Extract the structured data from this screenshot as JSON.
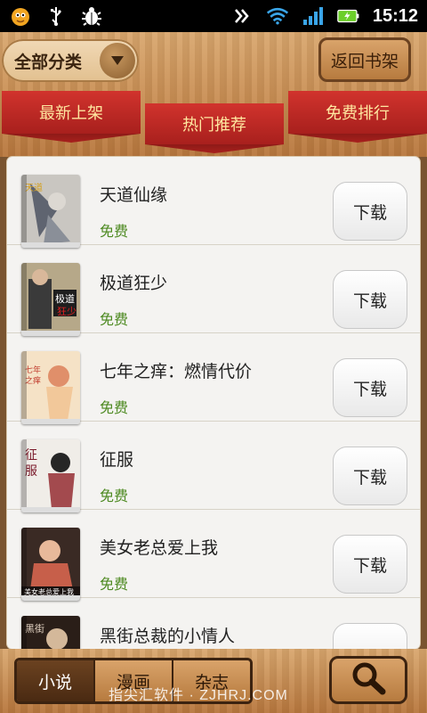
{
  "status_bar": {
    "time": "15:12",
    "icons": [
      "app-icon",
      "usb-icon",
      "bug-icon",
      "sync-icon",
      "wifi-icon",
      "signal-icon",
      "battery-icon"
    ],
    "battery_color": "#6ccf2a"
  },
  "header": {
    "category_label": "全部分类",
    "back_label": "返回书架",
    "tabs": [
      {
        "label": "最新上架",
        "active": false
      },
      {
        "label": "热门推荐",
        "active": true
      },
      {
        "label": "免费排行",
        "active": false
      }
    ]
  },
  "books": [
    {
      "title": "天道仙缘",
      "price": "免费",
      "action": "下载",
      "cover_colors": [
        "#c9c6c1",
        "#5f6470",
        "#dcd8d2"
      ]
    },
    {
      "title": "极道狂少",
      "price": "免费",
      "action": "下载",
      "cover_colors": [
        "#3a3a3a",
        "#b6a889",
        "#1e1e1e"
      ]
    },
    {
      "title": "七年之痒：燃情代价",
      "price": "免费",
      "action": "下载",
      "cover_colors": [
        "#f2c89a",
        "#e08f6a",
        "#f5e2c6"
      ]
    },
    {
      "title": "征服",
      "price": "免费",
      "action": "下载",
      "cover_colors": [
        "#f0ede8",
        "#a34a4e",
        "#262626"
      ]
    },
    {
      "title": "美女老总爱上我",
      "price": "免费",
      "action": "下载",
      "cover_colors": [
        "#3a2a24",
        "#c75f4a",
        "#e8b99a"
      ]
    },
    {
      "title": "黑街总裁的小情人",
      "price": "",
      "action": "",
      "cover_colors": [
        "#2a1e18",
        "#8a5a3a",
        "#d4b89a"
      ]
    }
  ],
  "bottom_tabs": [
    {
      "label": "小说",
      "active": true
    },
    {
      "label": "漫画",
      "active": false
    },
    {
      "label": "杂志",
      "active": false
    }
  ],
  "watermark": "指尖汇软件 · ZJHRJ.COM",
  "colors": {
    "ribbon": "#c0292a",
    "ribbon_text": "#ffe7a0",
    "price": "#4d8a21"
  }
}
